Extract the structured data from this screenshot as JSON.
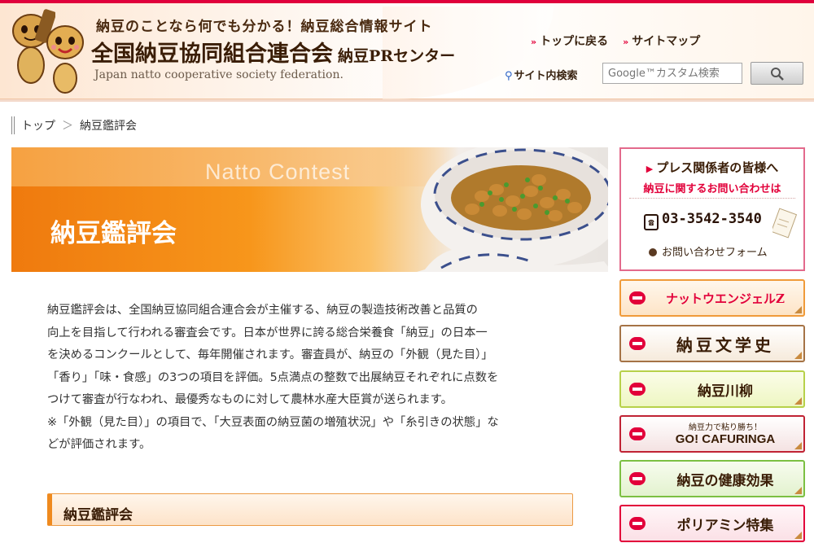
{
  "header": {
    "tagline": "納豆のことなら何でも分かる！納豆総合情報サイト",
    "site_name": "全国納豆協同組合連合会",
    "site_sub": "納豆PRセンター",
    "site_name_en": "Japan natto cooperative society federation.",
    "links": [
      {
        "label": "トップに戻る"
      },
      {
        "label": "サイトマップ"
      }
    ],
    "search_label": "サイト内検索",
    "search_placeholder": "Google™カスタム検索"
  },
  "breadcrumb": {
    "items": [
      "トップ",
      "納豆鑑評会"
    ],
    "separator": "＞"
  },
  "banner": {
    "en_title": "Natto Contest",
    "title": "納豆鑑評会"
  },
  "intro": {
    "lines": [
      "納豆鑑評会は、全国納豆協同組合連合会が主催する、納豆の製造技術改善と品質の",
      "向上を目指して行われる審査会です。日本が世界に誇る総合栄養食「納豆」の日本一",
      "を決めるコンクールとして、毎年開催されます。審査員が、納豆の「外観（見た目）」",
      "「香り」「味・食感」の3つの項目を評価。5点満点の整数で出展納豆それぞれに点数を",
      "つけて審査が行なわれ、最優秀なものに対して農林水産大臣賞が送られます。",
      "※「外観（見た目）」の項目で、「大豆表面の納豆菌の増殖状況」や「糸引きの状態」な",
      "どが評価されます。"
    ]
  },
  "section": {
    "heading": "納豆鑑評会"
  },
  "press": {
    "title": "プレス関係者の皆様へ",
    "subtitle": "納豆に関するお問い合わせは",
    "phone": "03-3542-3540",
    "form_link": "お問い合わせフォーム"
  },
  "side_nav": {
    "items": [
      {
        "label": "ナットウエンジェルZ"
      },
      {
        "label": "納豆文学史"
      },
      {
        "label": "納豆川柳"
      },
      {
        "small": "納豆力で粘り勝ち！",
        "label": "GO! CAFURINGA"
      },
      {
        "label": "納豆の健康効果"
      },
      {
        "label": "ポリアミン特集"
      }
    ]
  },
  "colors": {
    "accent_red": "#e2003a",
    "banner_orange": "#f7961b"
  }
}
